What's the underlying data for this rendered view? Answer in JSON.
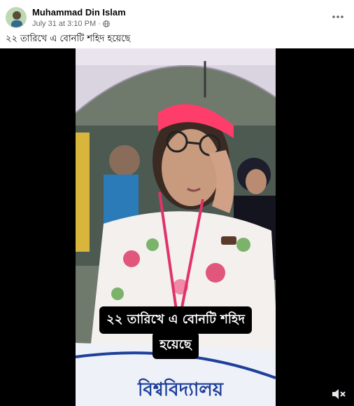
{
  "post": {
    "author": "Muhammad Din Islam",
    "timestamp": "July 31 at 3:10 PM",
    "separator": "·",
    "privacy_icon": "globe-icon",
    "more_icon": "more-options-icon",
    "caption": "২২ তারিখে এ বোনটি শহিদ হয়েছে"
  },
  "video": {
    "subtitle_line1": "২২ তারিখে এ বোনটি শহিদ",
    "subtitle_line2": "হয়েছে",
    "sign_text": "বিশ্ববিদ্যালয়",
    "volume_icon": "volume-muted-icon"
  },
  "colors": {
    "headband": "#ff3d6b",
    "umbrella": "#e9e4ee",
    "text_primary": "#050505",
    "text_secondary": "#65676b"
  }
}
